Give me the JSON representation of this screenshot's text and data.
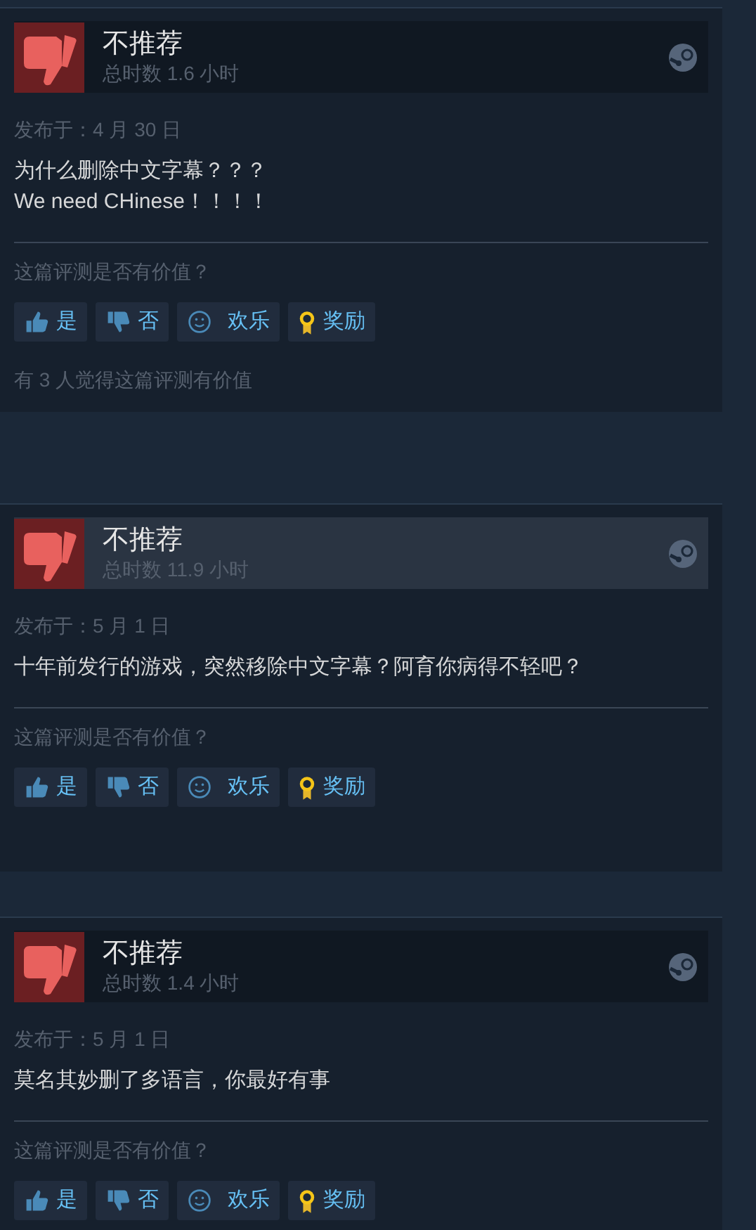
{
  "reviews": [
    {
      "verdict": "不推荐",
      "hours": "总时数 1.6 小时",
      "highlighted": false,
      "posted": "发布于：4 月 30 日",
      "body": [
        "为什么删除中文字幕？？？",
        "We need CHinese！！！！"
      ],
      "question": "这篇评测是否有价值？",
      "buttons": [
        {
          "kind": "yes",
          "label": "是"
        },
        {
          "kind": "no",
          "label": "否"
        },
        {
          "kind": "funny",
          "label": "欢乐"
        },
        {
          "kind": "award",
          "label": "奖励"
        }
      ],
      "helpful": "有 3 人觉得这篇评测有价值"
    },
    {
      "verdict": "不推荐",
      "hours": "总时数 11.9 小时",
      "highlighted": true,
      "posted": "发布于：5 月 1 日",
      "body": [
        "十年前发行的游戏，突然移除中文字幕？阿育你病得不轻吧？"
      ],
      "question": "这篇评测是否有价值？",
      "buttons": [
        {
          "kind": "yes",
          "label": "是"
        },
        {
          "kind": "no",
          "label": "否"
        },
        {
          "kind": "funny",
          "label": "欢乐"
        },
        {
          "kind": "award",
          "label": "奖励"
        }
      ]
    },
    {
      "verdict": "不推荐",
      "hours": "总时数 1.4 小时",
      "highlighted": false,
      "posted": "发布于：5 月 1 日",
      "body": [
        "莫名其妙删了多语言，你最好有事"
      ],
      "question": "这篇评测是否有价值？",
      "buttons": [
        {
          "kind": "yes",
          "label": "是"
        },
        {
          "kind": "no",
          "label": "否"
        },
        {
          "kind": "funny",
          "label": "欢乐"
        },
        {
          "kind": "award",
          "label": "奖励"
        }
      ]
    }
  ]
}
